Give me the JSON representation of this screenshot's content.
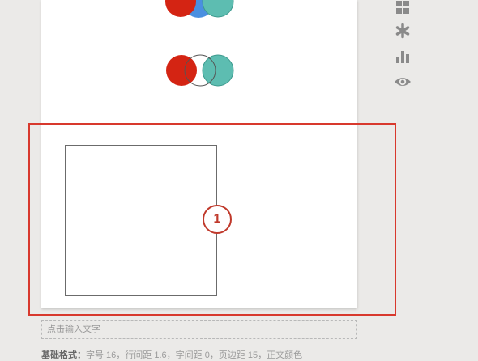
{
  "canvas": {
    "callout_number": "1"
  },
  "toolbar": {
    "tools": [
      {
        "name": "grid-icon"
      },
      {
        "name": "asterisk-icon"
      },
      {
        "name": "bar-chart-icon"
      },
      {
        "name": "eye-icon"
      }
    ]
  },
  "text_input": {
    "placeholder": "点击输入文字"
  },
  "format": {
    "label": "基础格式：",
    "text": "字号 16，行间距 1.6，字间距 0，页边距 15，正文颜色"
  },
  "colors": {
    "red": "#d42413",
    "teal": "#5dbdb1",
    "blue": "#4a8fe0",
    "highlight": "#d8392d"
  }
}
